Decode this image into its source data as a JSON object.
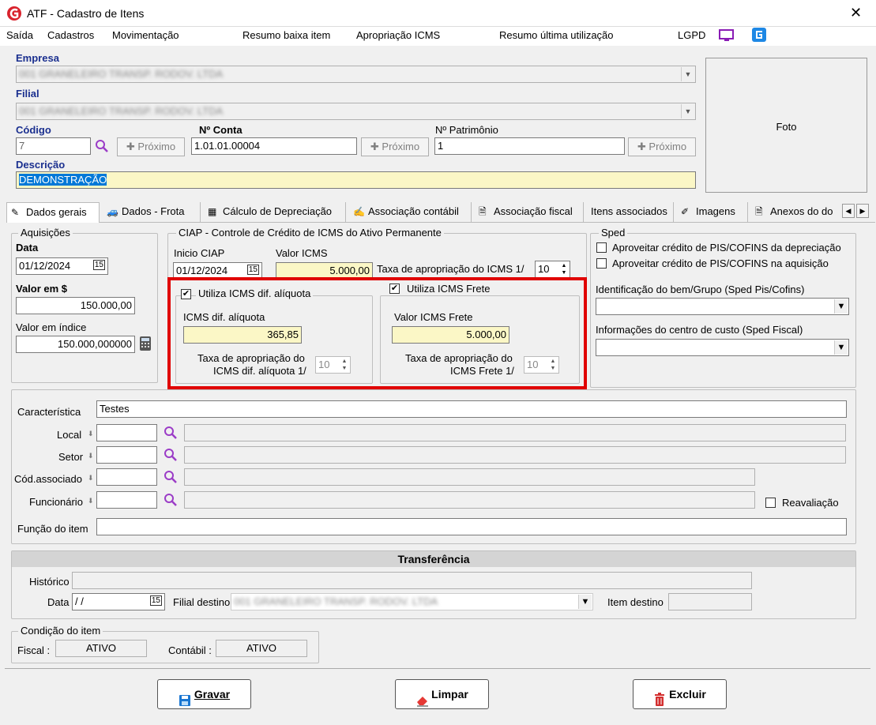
{
  "window": {
    "title": "ATF - Cadastro de Itens",
    "close": "✕"
  },
  "menu": {
    "items": [
      "Saída",
      "Cadastros",
      "Movimentação",
      "Resumo baixa item",
      "Apropriação ICMS",
      "Resumo última utilização",
      "LGPD"
    ]
  },
  "header": {
    "empresa_label": "Empresa",
    "empresa_value": "001 GRANELEIRO TRANSP. RODOV. LTDA",
    "filial_label": "Filial",
    "filial_value": "001 GRANELEIRO TRANSP. RODOV. LTDA",
    "codigo_label": "Código",
    "codigo_value": "7",
    "proximo_label": "Próximo",
    "conta_label": "Nº Conta",
    "conta_value": "1.01.01.00004",
    "patrimonio_label": "Nº Patrimônio",
    "patrimonio_value": "1",
    "descricao_label": "Descrição",
    "descricao_value": "DEMONSTRAÇÃO",
    "foto_label": "Foto"
  },
  "tabs": [
    {
      "label": "Dados gerais",
      "icon": "pencil-icon"
    },
    {
      "label": "Dados - Frota",
      "icon": "car-icon"
    },
    {
      "label": "Cálculo de Depreciação",
      "icon": "calculator-icon"
    },
    {
      "label": "Associação contábil",
      "icon": "edit-icon"
    },
    {
      "label": "Associação fiscal",
      "icon": "document-icon"
    },
    {
      "label": "Itens associados",
      "icon": ""
    },
    {
      "label": "Imagens",
      "icon": "paint-icon"
    },
    {
      "label": "Anexos do do",
      "icon": "document-icon"
    }
  ],
  "aquisicoes": {
    "legend": "Aquisições",
    "data_label": "Data",
    "data_value": "01/12/2024",
    "valor_label": "Valor em $",
    "valor_value": "150.000,00",
    "indice_label": "Valor em índice",
    "indice_value": "150.000,000000"
  },
  "ciap": {
    "legend": "CIAP - Controle de Crédito de ICMS do Ativo Permanente",
    "inicio_label": "Inicio CIAP",
    "inicio_value": "01/12/2024",
    "valor_icms_label": "Valor ICMS",
    "valor_icms_value": "5.000,00",
    "taxa_label": "Taxa de apropriação do ICMS 1/",
    "taxa_value": "10",
    "dif_aliquota": {
      "check_label": "Utiliza ICMS dif. alíquota",
      "checked": "✔",
      "icms_label": "ICMS dif. alíquota",
      "icms_value": "365,85",
      "taxa_label_1": "Taxa de apropriação do",
      "taxa_label_2": "ICMS dif. alíquota 1/",
      "taxa_value": "10"
    },
    "frete": {
      "check_label": "Utiliza ICMS Frete",
      "checked": "✔",
      "icms_label": "Valor ICMS Frete",
      "icms_value": "5.000,00",
      "taxa_label_1": "Taxa de apropriação do",
      "taxa_label_2": "ICMS Frete 1/",
      "taxa_value": "10"
    }
  },
  "sped": {
    "legend": "Sped",
    "check1": "Aproveitar crédito de PIS/COFINS da depreciação",
    "check2": "Aproveitar crédito de PIS/COFINS na aquisição",
    "ident_label": "Identificação do bem/Grupo (Sped Pis/Cofins)",
    "custo_label": "Informações do centro de custo (Sped Fiscal)"
  },
  "detalhes": {
    "caracteristica_label": "Característica",
    "caracteristica_value": "Testes",
    "local_label": "Local",
    "setor_label": "Setor",
    "cod_assoc_label": "Cód.associado",
    "funcionario_label": "Funcionário",
    "reavaliacao_label": "Reavaliação",
    "funcao_label": "Função do item"
  },
  "transferencia": {
    "title": "Transferência",
    "historico_label": "Histórico",
    "data_label": "Data",
    "data_value": "/  /",
    "filial_label": "Filial destino",
    "filial_value": "001 GRANELEIRO TRANSP. RODOV. LTDA",
    "item_label": "Item destino"
  },
  "condicao": {
    "legend": "Condição do item",
    "fiscal_label": "Fiscal :",
    "fiscal_value": "ATIVO",
    "contabil_label": "Contábil :",
    "contabil_value": "ATIVO"
  },
  "buttons": {
    "gravar": "Gravar",
    "limpar": "Limpar",
    "excluir": "Excluir"
  },
  "colors": {
    "accent_label": "#1a2f8f",
    "highlight_box": "#e00000",
    "yellow_field": "#fbf7c6",
    "selection": "#0078d7"
  }
}
